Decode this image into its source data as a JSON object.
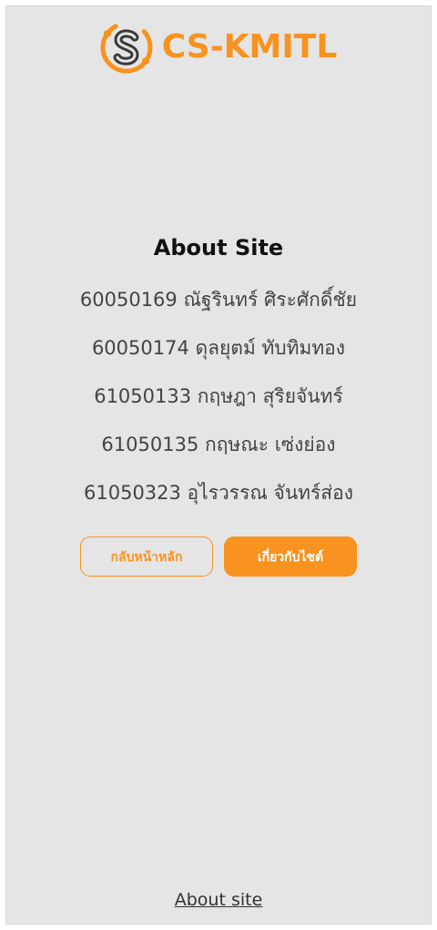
{
  "header": {
    "brand_name": "CS-KMITL",
    "logo_icon": "cs-kmitl-logo-icon",
    "brand_color": "#f7931e"
  },
  "main": {
    "title": "About Site",
    "members": [
      "60050169 ณัฐรินทร์ ศิระศักดิ์ชัย",
      "60050174 ดุลยุตม์ ทับทิมทอง",
      "61050133 กฤษฎา สุริยจันทร์",
      "61050135 กฤษณะ เซ่งย่อง",
      "61050323 อุไรวรรณ จันทร์ส่อง"
    ],
    "buttons": {
      "home_label": "กลับหน้าหลัก",
      "about_label": "เกี่ยวกับไซต์"
    }
  },
  "footer": {
    "link_label": "About site"
  }
}
